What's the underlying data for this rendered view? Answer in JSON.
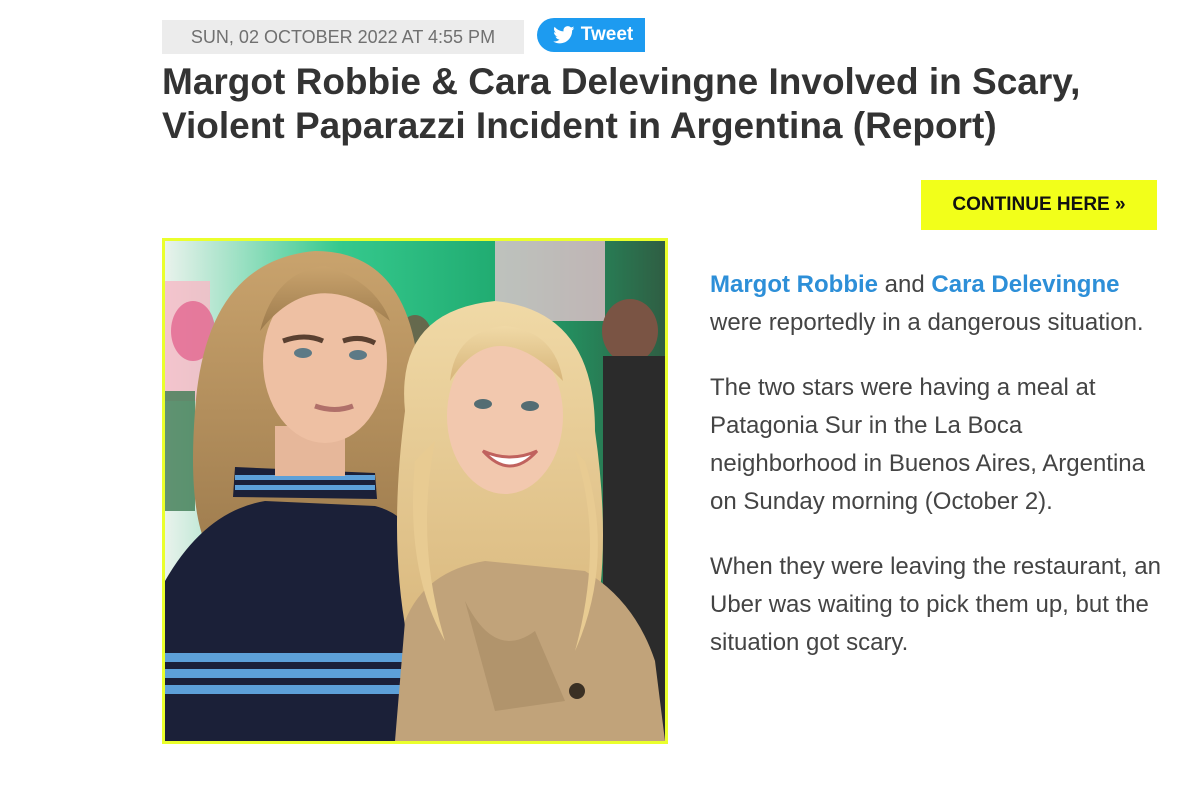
{
  "meta": {
    "date": "SUN, 02 OCTOBER 2022 AT 4:55 PM",
    "tweet_label": "Tweet"
  },
  "headline": {
    "line1": "Margot Robbie & Cara Delevingne Involved in Scary,",
    "line2": "Violent Paparazzi Incident in Argentina (Report)"
  },
  "continue_label": "CONTINUE HERE »",
  "photo": {
    "icon": "photo-of-two-women"
  },
  "article": {
    "p1": {
      "link1": "Margot Robbie",
      "and": " and ",
      "link2": "Cara Delevingne",
      "rest": " were reportedly in a dangerous situation."
    },
    "p2": "The two stars were having a meal at Patagonia Sur in the La Boca neighborhood in Buenos Aires, Argentina on Sunday morning (October 2).",
    "p3": "When they were leaving the restaurant, an Uber was waiting to pick them up, but the situation got scary."
  },
  "colors": {
    "accent_link": "#2d8fd8",
    "tweet": "#1d9bf0",
    "cta_yellow": "#f2ff1a",
    "photo_border": "#eaff2c"
  }
}
